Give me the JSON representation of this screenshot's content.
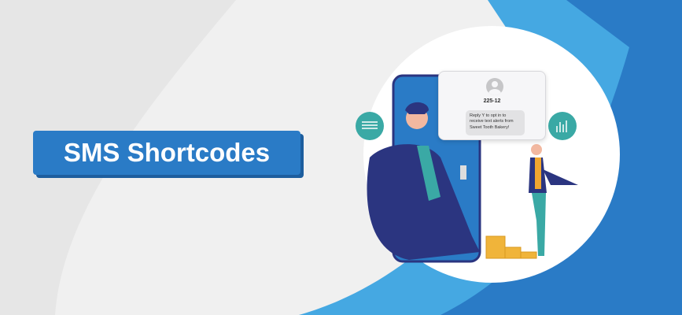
{
  "banner": {
    "title": "SMS Shortcodes"
  },
  "message": {
    "sender": "225-12",
    "text": "Reply Y to opt in to receive text alerts from Sweet Tooth Bakery!"
  },
  "colors": {
    "primary": "#2a7bc6",
    "light_blue": "#45a8e2",
    "teal": "#3aa9a5",
    "navy": "#2b3580"
  }
}
